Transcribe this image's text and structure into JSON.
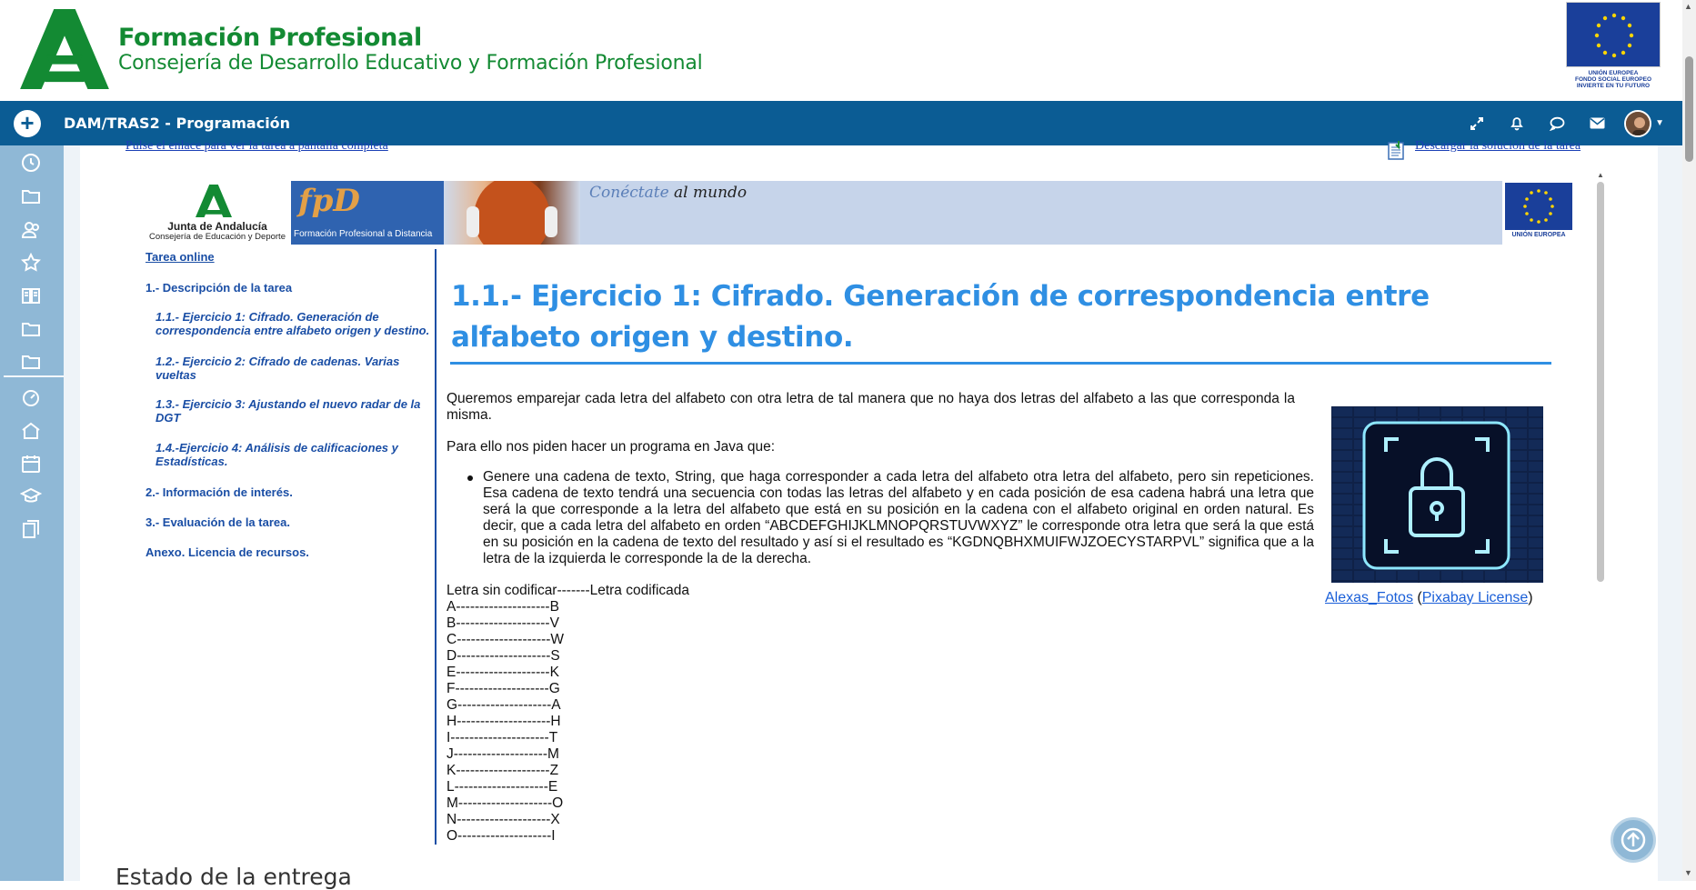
{
  "header": {
    "brand_title": "Formación Profesional",
    "brand_subtitle": "Consejería de Desarrollo Educativo y Formación Profesional",
    "eu_logo_text": "UNIÓN EUROPEA\nFONDO SOCIAL EUROPEO\nINVIERTE EN TU FUTURO"
  },
  "navbar": {
    "course_title": "DAM/TRAS2 - Programación",
    "icons": [
      "expand-icon",
      "bell-icon",
      "chat-icon",
      "mail-icon"
    ],
    "bg_color": "#0b5c94"
  },
  "sidebar": {
    "icons": [
      "clock-icon",
      "folder-icon",
      "users-icon",
      "star-icon",
      "book-icon",
      "folder-icon",
      "folder-icon",
      "gauge-icon",
      "home-icon",
      "calendar-icon",
      "graduation-cap-icon",
      "files-icon"
    ],
    "bg_color": "#8fb8d6"
  },
  "content": {
    "link_fullscreen": "Pulse el enlace para ver la tarea a pantalla completa",
    "link_solution": "Descargar la solución de la tarea",
    "banner": {
      "junta_name": "Junta de Andalucía",
      "junta_dept": "Consejería de Educación y Deporte",
      "fpd_logo": "fpD",
      "fpd_text": "Formación Profesional a Distancia",
      "slogan_a": "Conéctate",
      "slogan_b": "al mundo",
      "ue_label": "UNIÓN EUROPEA"
    },
    "toc": {
      "online": "Tarea online",
      "item1": "1.- Descripción de la tarea",
      "sub1": "1.1.- Ejercicio 1: Cifrado. Generación de correspondencia entre alfabeto origen y destino.",
      "sub2": "1.2.- Ejercicio 2: Cifrado de cadenas. Varias vueltas",
      "sub3": "1.3.- Ejercicio 3: Ajustando el nuevo radar de la DGT",
      "sub4": "1.4.-Ejercicio 4: Análisis de calificaciones y Estadísticas.",
      "item2": "2.- Información de interés.",
      "item3": "3.- Evaluación de la tarea.",
      "annex": "Anexo. Licencia de recursos."
    },
    "article": {
      "title": "1.1.- Ejercicio 1: Cifrado. Generación de correspondencia entre alfabeto origen y destino.",
      "intro": "Queremos emparejar cada letra del alfabeto con otra letra de tal manera que no haya dos letras del alfabeto a las que corresponda la misma.",
      "para2": "Para ello nos piden hacer un programa en Java que:",
      "bullet": "Genere una cadena de texto, String, que haga corresponder a cada letra del alfabeto otra letra del alfabeto, pero sin repeticiones. Esa cadena de texto tendrá una secuencia con todas las letras del alfabeto y en cada posición de esa cadena habrá una letra  que será la que corresponde  a la letra del alfabeto  que está en su posición en la cadena con el alfabeto original en orden natural. Es decir, que a cada  letra del alfabeto en orden “ABCDEFGHIJKLMNOPQRSTUVWXYZ” le corresponde otra letra que será la que está en su posición en la cadena de texto del resultado y así si el resultado es “KGDNQBHXMUIFWJZOECYSTARPVL” significa que a la letra de la izquierda le corresponde la de la derecha.",
      "mapping_header": "Letra sin codificar-------Letra codificada",
      "mapping": [
        "A--------------------B",
        "B--------------------V",
        "C--------------------W",
        "D--------------------S",
        "E--------------------K",
        "F--------------------G",
        "G--------------------A",
        "H--------------------H",
        "I---------------------T",
        "J--------------------M",
        "K--------------------Z",
        "L--------------------E",
        "M--------------------O",
        "N--------------------X",
        "O--------------------I"
      ],
      "caption_author": "Alexas_Fotos",
      "caption_open": " (",
      "caption_license": "Pixabay License",
      "caption_close": ")"
    },
    "section_heading": "Estado de la entrega"
  }
}
